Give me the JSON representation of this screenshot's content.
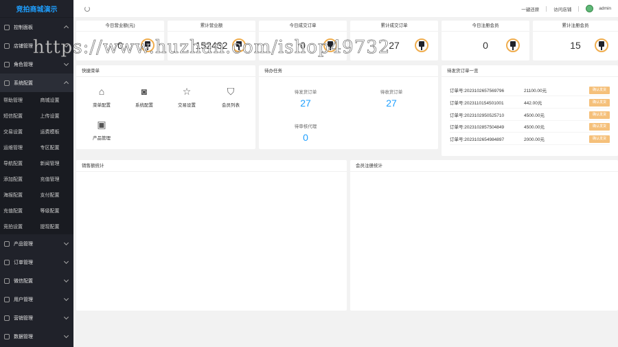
{
  "sidebar": {
    "brand": "竞拍商城演示",
    "items_top": [
      {
        "label": "控制面板",
        "icon": "home-icon"
      },
      {
        "label": "店铺管理",
        "icon": "home-icon"
      },
      {
        "label": "角色管理",
        "icon": "home-icon"
      },
      {
        "label": "系统配置",
        "icon": "home-icon"
      }
    ],
    "sub_items": [
      "帮助管理",
      "商城设置",
      "短信配置",
      "上传设置",
      "交易设置",
      "运费模板",
      "运维管理",
      "专区配置",
      "导航配置",
      "新闻管理",
      "添加配置",
      "充值管理",
      "海报配置",
      "支付配置",
      "充值配置",
      "等级配置",
      "竞拍设置",
      "提现配置"
    ],
    "items_bottom": [
      {
        "label": "产品管理",
        "icon": "home-icon"
      },
      {
        "label": "订单管理",
        "icon": "home-icon"
      },
      {
        "label": "微信配置",
        "icon": "home-icon"
      },
      {
        "label": "用户管理",
        "icon": "home-icon"
      },
      {
        "label": "营销管理",
        "icon": "home-icon"
      },
      {
        "label": "数据管理",
        "icon": "home-icon"
      }
    ]
  },
  "header": {
    "clear_cache": "一键还原",
    "visit_store": "访问店铺",
    "username": "admin"
  },
  "stats": [
    {
      "title": "今日营业额(元)",
      "value": "0"
    },
    {
      "title": "累计营业额",
      "value": "152432"
    },
    {
      "title": "今日成交订单",
      "value": "0"
    },
    {
      "title": "累计成交订单",
      "value": "27"
    },
    {
      "title": "今日注册会员",
      "value": "0"
    },
    {
      "title": "累计注册会员",
      "value": "15"
    }
  ],
  "quick_menu": {
    "title": "快捷菜单",
    "items": [
      {
        "label": "菜单配置",
        "glyph": "⌂",
        "icon": "home-icon"
      },
      {
        "label": "系统配置",
        "glyph": "◙",
        "icon": "camera-icon"
      },
      {
        "label": "交易设置",
        "glyph": "☆",
        "icon": "star-icon"
      },
      {
        "label": "会员列表",
        "glyph": "⛉",
        "icon": "shield-icon"
      },
      {
        "label": "产品管理",
        "glyph": "▣",
        "icon": "grid-icon"
      }
    ]
  },
  "todo": {
    "title": "待办任务",
    "items": [
      {
        "label": "待发货订单",
        "value": "27"
      },
      {
        "label": "待收货订单",
        "value": "27"
      },
      {
        "label": "待审核代理",
        "value": "0"
      }
    ]
  },
  "orders": {
    "title": "待发货订单一览",
    "button_label": "确认发货",
    "rows": [
      {
        "no": "订单号:20231026575697​96",
        "amount": "21100.00元"
      },
      {
        "no": "订单号:2023110154501001",
        "amount": "442.00元"
      },
      {
        "no": "订单号:2023102950525710",
        "amount": "4500.00元"
      },
      {
        "no": "订单号:2023102857504849",
        "amount": "4500.00元"
      },
      {
        "no": "订单号:2023102654984897",
        "amount": "2000.00元"
      }
    ]
  },
  "sales_chart": {
    "title": "销售额统计"
  },
  "member_chart": {
    "title": "会员注册统计"
  },
  "watermark": "https://www.huzhan.com/ishop49732"
}
